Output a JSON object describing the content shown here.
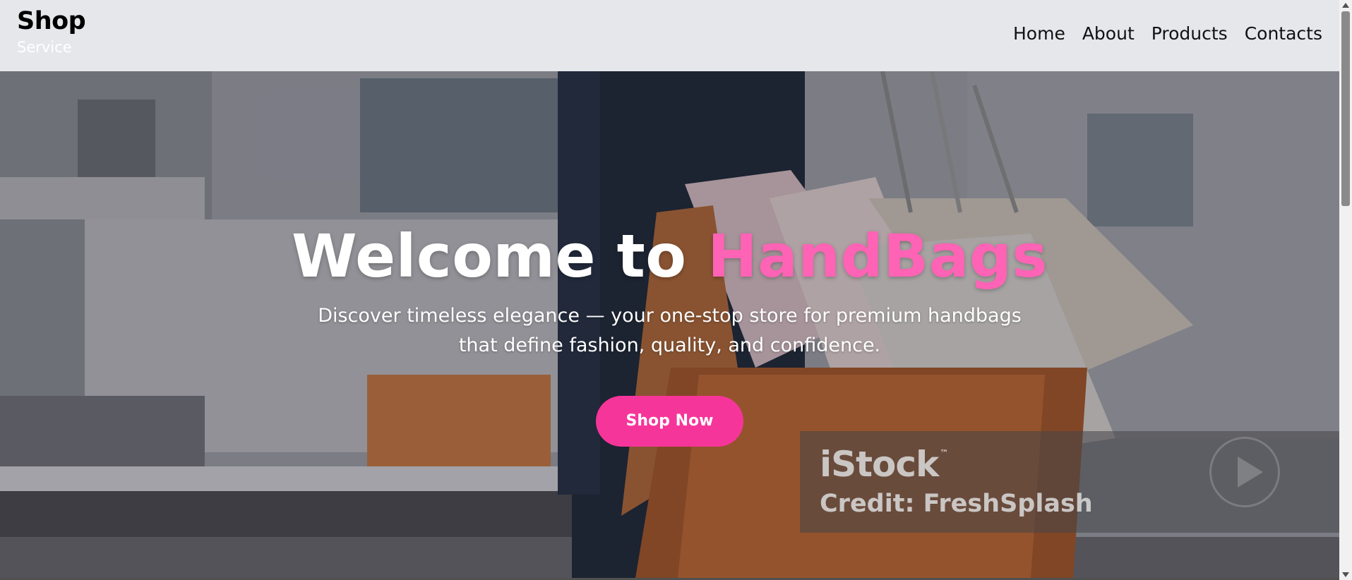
{
  "header": {
    "brand_title": "Shop",
    "brand_subtitle": "Service",
    "nav": [
      {
        "label": "Home"
      },
      {
        "label": "About"
      },
      {
        "label": "Products"
      },
      {
        "label": "Contacts"
      }
    ]
  },
  "hero": {
    "title_prefix": "Welcome to ",
    "title_accent": "HandBags",
    "description": "Discover timeless elegance — your one-stop store for premium handbags that define fashion, quality, and confidence.",
    "cta_label": "Shop Now"
  },
  "watermark": {
    "logo": "iStock",
    "tm": "™",
    "credit": "Credit: FreshSplash"
  },
  "colors": {
    "accent": "#ff63b5",
    "button": "#f6359a",
    "header_bg": "#e6e7eb"
  },
  "icons": [
    "scroll-up-arrow-icon",
    "scroll-down-arrow-icon",
    "play-icon"
  ]
}
